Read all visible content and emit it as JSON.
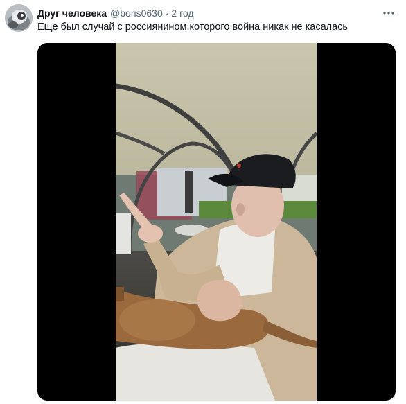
{
  "tweet": {
    "display_name": "Друг человека",
    "handle": "@boris0630",
    "separator": "·",
    "timestamp": "2 год",
    "text": "Еще был случай с россиянином,которого война никак не касалась"
  },
  "icons": {
    "more": "more-horizontal-icon",
    "avatar": "avatar-image"
  },
  "colors": {
    "name": "#0f1419",
    "secondary": "#536471",
    "media_background": "#000000"
  }
}
